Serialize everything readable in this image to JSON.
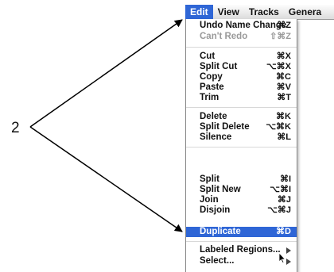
{
  "callout": {
    "number": "2"
  },
  "menubar": {
    "items": [
      "Edit",
      "View",
      "Tracks",
      "Genera"
    ]
  },
  "menu": {
    "items": [
      {
        "label": "Undo Name Change",
        "shortcut": "⌘Z"
      },
      {
        "label": "Can't Redo",
        "shortcut": "⇧⌘Z"
      },
      {
        "label": "Cut",
        "shortcut": "⌘X"
      },
      {
        "label": "Split Cut",
        "shortcut": "⌥⌘X"
      },
      {
        "label": "Copy",
        "shortcut": "⌘C"
      },
      {
        "label": "Paste",
        "shortcut": "⌘V"
      },
      {
        "label": "Trim",
        "shortcut": "⌘T"
      },
      {
        "label": "Delete",
        "shortcut": "⌘K"
      },
      {
        "label": "Split Delete",
        "shortcut": "⌥⌘K"
      },
      {
        "label": "Silence",
        "shortcut": "⌘L"
      },
      {
        "label": "Split",
        "shortcut": "⌘I"
      },
      {
        "label": "Split New",
        "shortcut": "⌥⌘I"
      },
      {
        "label": "Join",
        "shortcut": "⌘J"
      },
      {
        "label": "Disjoin",
        "shortcut": "⌥⌘J"
      },
      {
        "label": "Duplicate",
        "shortcut": "⌘D"
      },
      {
        "label": "Labeled Regions..."
      },
      {
        "label": "Select..."
      }
    ]
  },
  "colors": {
    "highlight": "#2f66d6",
    "disabled_text": "#9a9a9a"
  }
}
